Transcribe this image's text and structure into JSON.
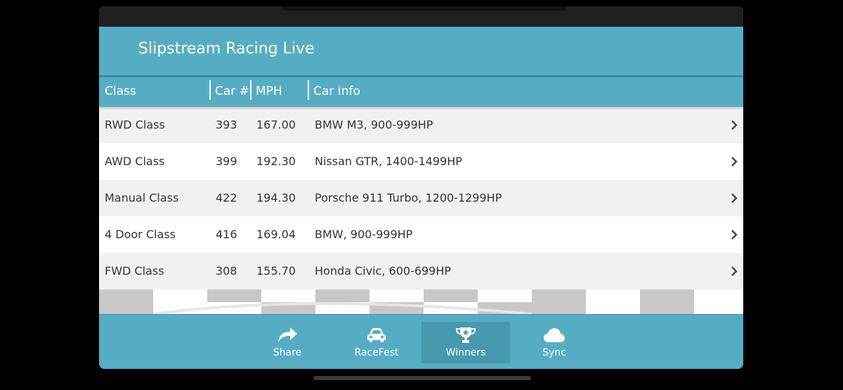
{
  "app": {
    "title": "Slipstream Racing Live"
  },
  "table": {
    "headers": {
      "class": "Class",
      "car": "Car #",
      "mph": "MPH",
      "info": "Car Info"
    },
    "rows": [
      {
        "class": "RWD Class",
        "car": "393",
        "mph": "167.00",
        "info": "BMW M3, 900-999HP"
      },
      {
        "class": "AWD Class",
        "car": "399",
        "mph": "192.30",
        "info": "Nissan GTR, 1400-1499HP"
      },
      {
        "class": "Manual Class",
        "car": "422",
        "mph": "194.30",
        "info": "Porsche 911 Turbo, 1200-1299HP"
      },
      {
        "class": "4 Door Class",
        "car": "416",
        "mph": "169.04",
        "info": "BMW, 900-999HP"
      },
      {
        "class": "FWD Class",
        "car": "308",
        "mph": "155.70",
        "info": "Honda Civic, 600-699HP"
      }
    ]
  },
  "tabs": [
    {
      "label": "Share",
      "icon": "share-icon",
      "active": false
    },
    {
      "label": "RaceFest",
      "icon": "car-icon",
      "active": false
    },
    {
      "label": "Winners",
      "icon": "trophy-icon",
      "active": true
    },
    {
      "label": "Sync",
      "icon": "cloud-icon",
      "active": false
    }
  ],
  "colors": {
    "accent": "#56adc3",
    "accent_dark": "#4799ae",
    "row_alt": "#f1f1f1"
  }
}
